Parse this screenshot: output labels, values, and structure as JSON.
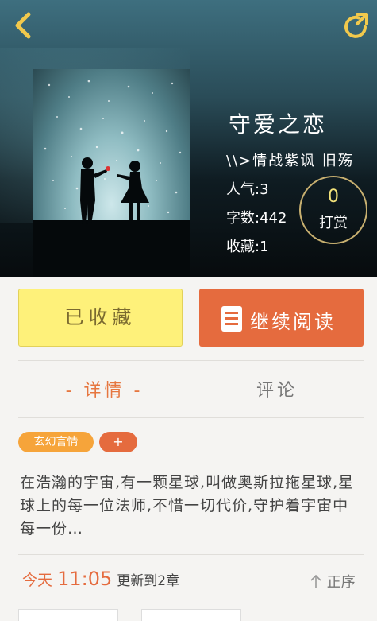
{
  "book": {
    "title": "守爱之恋",
    "author": "\\\\>情战紫讽 旧殇",
    "popularity": "人气:3",
    "word_count": "字数:442",
    "favorites": "收藏:1"
  },
  "tip": {
    "count": "0",
    "label": "打赏"
  },
  "actions": {
    "collect_label": "已收藏",
    "read_label": "继续阅读"
  },
  "tabs": [
    {
      "label": "- 详情 -",
      "active": true
    },
    {
      "label": "评论",
      "active": false
    }
  ],
  "tags": {
    "genre": "玄幻言情",
    "add": "+"
  },
  "description": "在浩瀚的宇宙,有一颗星球,叫做奥斯拉拖星球,星球上的每一位法师,不惜一切代价,守护着宇宙中每一份…",
  "update": {
    "day": "今天",
    "time": "11:05",
    "rest": "更新到2章"
  },
  "sort_label": "正序",
  "colors": {
    "accent": "#e56b3e",
    "collect_bg": "#fef17a",
    "tag_genre": "#f6a43a"
  }
}
